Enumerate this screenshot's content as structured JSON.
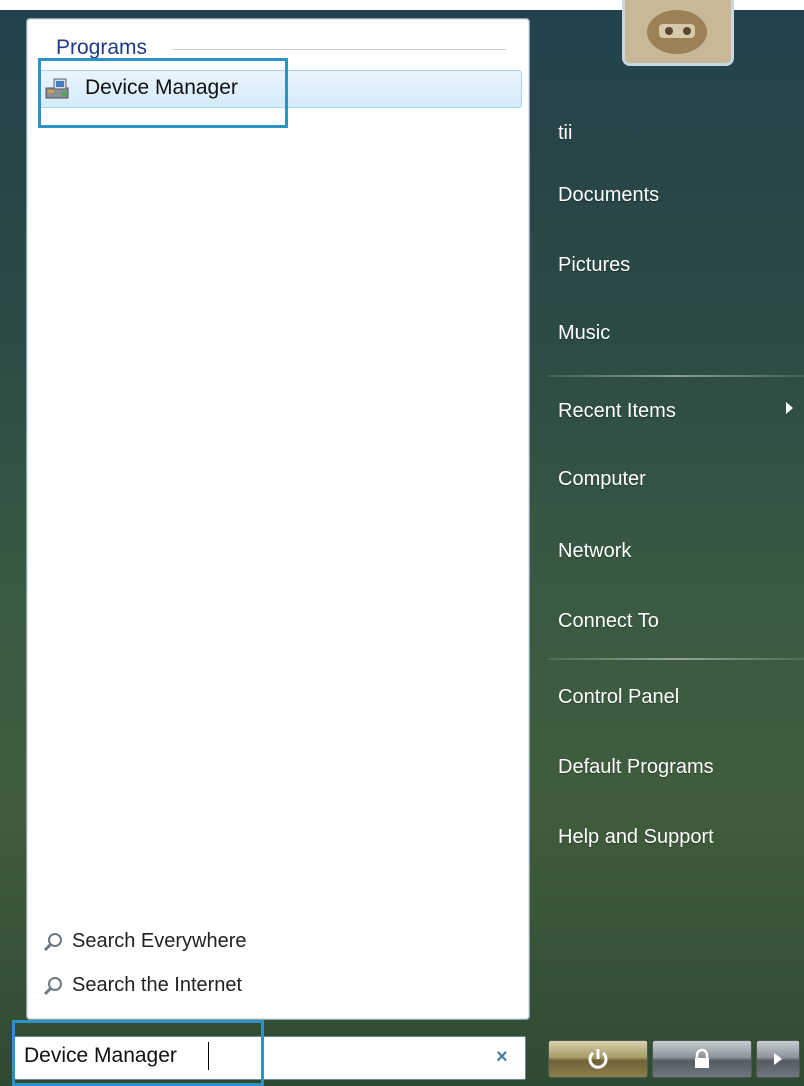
{
  "left_pane": {
    "section_heading": "Programs",
    "result_label": "Device Manager",
    "search_everywhere": "Search Everywhere",
    "search_internet": "Search the Internet"
  },
  "right_pane": {
    "user": "tii",
    "items": [
      "Documents",
      "Pictures",
      "Music",
      "Recent Items",
      "Computer",
      "Network",
      "Connect To",
      "Control Panel",
      "Default Programs",
      "Help and Support"
    ]
  },
  "search": {
    "value": "Device Manager",
    "clear_symbol": "×"
  },
  "colors": {
    "highlight": "#2b93c8",
    "heading": "#1e3a8a"
  },
  "icons": {
    "result": "device-manager-icon",
    "search": "magnifier-icon",
    "power": "power-icon",
    "lock": "lock-icon",
    "more": "arrow-right-icon"
  }
}
